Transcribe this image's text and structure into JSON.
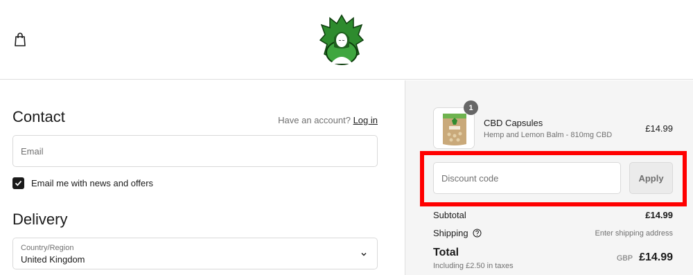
{
  "header": {
    "cart_icon": "shopping-bag-icon",
    "logo": "green-leaf-woman-logo"
  },
  "contact": {
    "title": "Contact",
    "account_prompt": "Have an account?",
    "login_label": "Log in",
    "email_placeholder": "Email",
    "newsletter_label": "Email me with news and offers",
    "newsletter_checked": true
  },
  "delivery": {
    "title": "Delivery",
    "country_label": "Country/Region",
    "country_value": "United Kingdom"
  },
  "order": {
    "items": [
      {
        "quantity": "1",
        "name": "CBD Capsules",
        "variant": "Hemp and Lemon Balm - 810mg CBD",
        "price": "£14.99"
      }
    ],
    "discount_placeholder": "Discount code",
    "apply_label": "Apply",
    "subtotal_label": "Subtotal",
    "subtotal_value": "£14.99",
    "shipping_label": "Shipping",
    "shipping_value": "Enter shipping address",
    "total_label": "Total",
    "taxes_note": "Including £2.50 in taxes",
    "currency": "GBP",
    "total_value": "£14.99"
  },
  "colors": {
    "accent_dark": "#1a1a1a",
    "sidebar_bg": "#f5f5f5",
    "highlight": "#ff0000",
    "logo_green": "#2e8b2e"
  }
}
